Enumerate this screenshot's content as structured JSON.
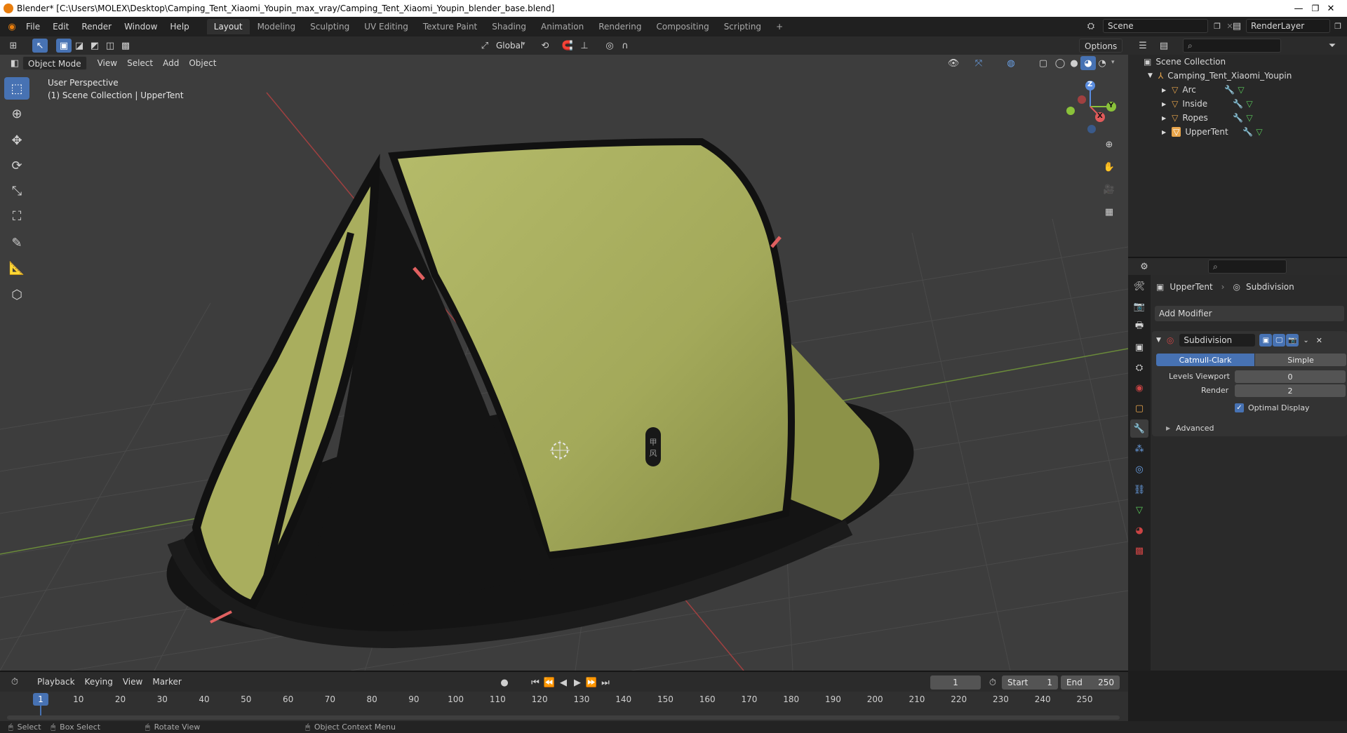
{
  "window": {
    "title": "Blender* [C:\\Users\\MOLEX\\Desktop\\Camping_Tent_Xiaomi_Youpin_max_vray/Camping_Tent_Xiaomi_Youpin_blender_base.blend]",
    "minimize": "—",
    "restore": "❐",
    "close": "✕"
  },
  "menu": {
    "items": [
      "File",
      "Edit",
      "Render",
      "Window",
      "Help"
    ],
    "workspaces": [
      "Layout",
      "Modeling",
      "Sculpting",
      "UV Editing",
      "Texture Paint",
      "Shading",
      "Animation",
      "Rendering",
      "Compositing",
      "Scripting"
    ],
    "add_workspace": "+",
    "scene": "Scene",
    "render_layer": "RenderLayer"
  },
  "viewport_header": {
    "transform_orientation": "Global",
    "options": "Options",
    "mode": "Object Mode",
    "menus": [
      "View",
      "Select",
      "Add",
      "Object"
    ]
  },
  "viewport": {
    "perspective": "User Perspective",
    "collection_info": "(1) Scene Collection | UpperTent",
    "tent_logo": "甲\n风",
    "gizmo": {
      "x": "X",
      "y": "Y",
      "z": "Z"
    }
  },
  "outliner": {
    "root": "Scene Collection",
    "collection": "Camping_Tent_Xiaomi_Youpin",
    "objects": [
      "Arc",
      "Inside",
      "Ropes",
      "UpperTent"
    ]
  },
  "properties": {
    "object_name": "UpperTent",
    "modifier_context": "Subdivision",
    "add_modifier": "Add Modifier",
    "modifier": {
      "name": "Subdivision",
      "types": [
        "Catmull-Clark",
        "Simple"
      ],
      "active_type": "Catmull-Clark",
      "levels_viewport_label": "Levels Viewport",
      "levels_viewport": "0",
      "render_label": "Render",
      "render": "2",
      "optimal_display_label": "Optimal Display",
      "optimal_display": true,
      "advanced": "Advanced"
    }
  },
  "timeline": {
    "menus": [
      "Playback",
      "Keying",
      "View",
      "Marker"
    ],
    "current_frame": "1",
    "start_label": "Start",
    "start": "1",
    "end_label": "End",
    "end": "250",
    "ticks": [
      "1",
      "10",
      "20",
      "30",
      "40",
      "50",
      "60",
      "70",
      "80",
      "90",
      "100",
      "110",
      "120",
      "130",
      "140",
      "150",
      "160",
      "170",
      "180",
      "190",
      "200",
      "210",
      "220",
      "230",
      "240",
      "250"
    ]
  },
  "status": {
    "select": "Select",
    "box_select": "Box Select",
    "rotate_view": "Rotate View",
    "context_menu": "Object Context Menu"
  },
  "colors": {
    "accent": "#4772b3",
    "tent_green": "#a3a95a",
    "tent_dark": "#141414",
    "viewport_bg": "#3d3d3d",
    "object_orange": "#e8a54b"
  }
}
